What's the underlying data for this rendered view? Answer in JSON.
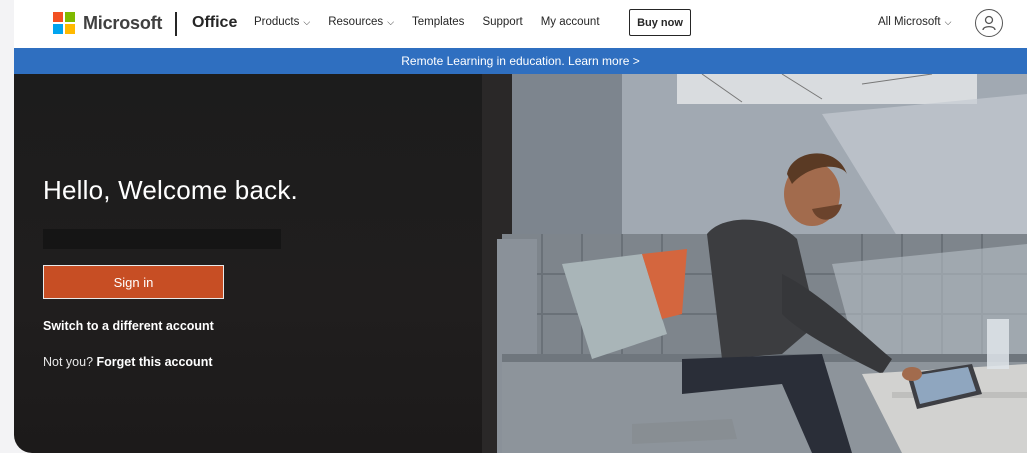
{
  "header": {
    "brand": "Microsoft",
    "product": "Office",
    "nav": [
      {
        "label": "Products",
        "has_dropdown": true
      },
      {
        "label": "Resources",
        "has_dropdown": true
      },
      {
        "label": "Templates",
        "has_dropdown": false
      },
      {
        "label": "Support",
        "has_dropdown": false
      },
      {
        "label": "My account",
        "has_dropdown": false
      }
    ],
    "buy_now": "Buy now",
    "all_microsoft": "All Microsoft",
    "chevron": "⌵"
  },
  "banner": {
    "text": "Remote Learning in education. Learn more >"
  },
  "signin": {
    "greeting": "Hello, Welcome back.",
    "email_value": "",
    "button": "Sign in",
    "switch_account": "Switch to a different account",
    "not_you": "Not you?",
    "forget": "Forget this account"
  },
  "colors": {
    "banner_bg": "#2f6fc0",
    "signin_button": "#c74e24",
    "hero_dark": "#1c1c1c",
    "ms_red": "#f25022",
    "ms_green": "#7fba00",
    "ms_blue": "#00a4ef",
    "ms_yellow": "#ffb900"
  },
  "icons": {
    "account": "account-circle-icon",
    "dropdown": "chevron-down-icon"
  }
}
